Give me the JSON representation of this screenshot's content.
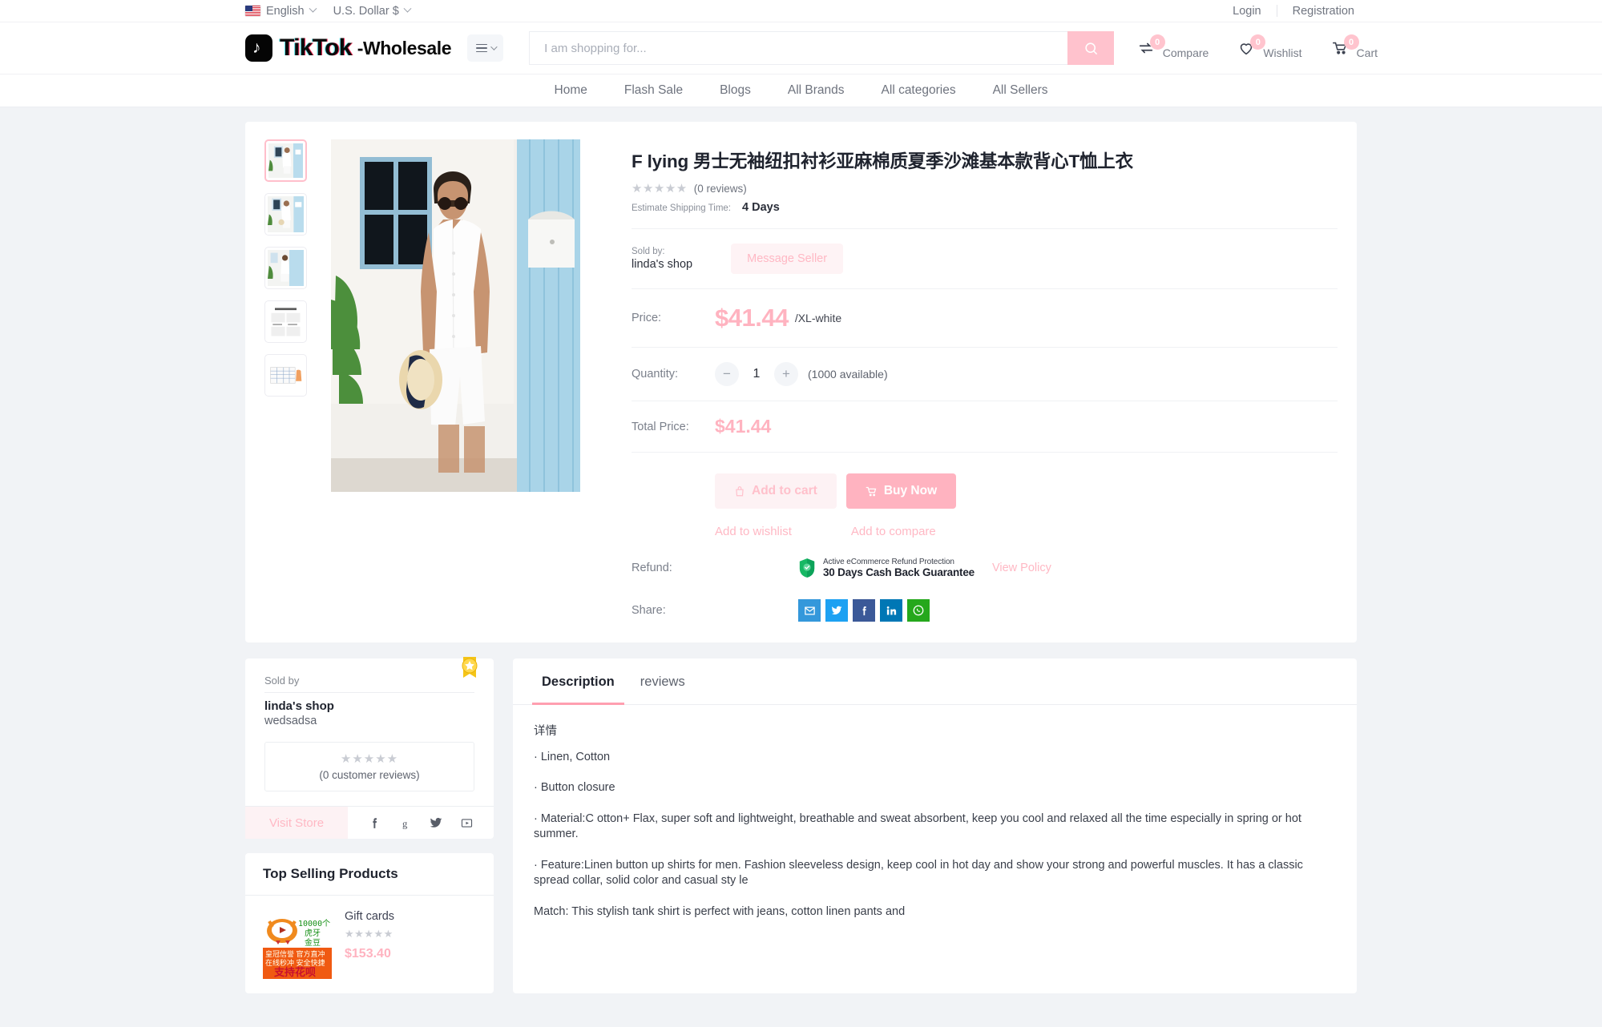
{
  "topbar": {
    "language": "English",
    "currency": "U.S. Dollar $",
    "login": "Login",
    "registration": "Registration"
  },
  "header": {
    "logo_text": "TikTok",
    "logo_suffix": "-Wholesale",
    "search_placeholder": "I am shopping for...",
    "icons": [
      {
        "name": "compare",
        "label": "Compare",
        "count": "0"
      },
      {
        "name": "wishlist",
        "label": "Wishlist",
        "count": "0"
      },
      {
        "name": "cart",
        "label": "Cart",
        "count": "0"
      }
    ]
  },
  "nav": {
    "items": [
      "Home",
      "Flash Sale",
      "Blogs",
      "All Brands",
      "All categories",
      "All Sellers"
    ]
  },
  "product": {
    "title": "F lying 男士无袖纽扣衬衫亚麻棉质夏季沙滩基本款背心T恤上衣",
    "stars": "★★★★★",
    "reviews_text": "(0 reviews)",
    "shipping_label": "Estimate Shipping Time:",
    "shipping_value": "4 Days",
    "sold_by_label": "Sold by:",
    "seller_name": "linda's shop",
    "message_seller": "Message Seller",
    "price_label": "Price:",
    "price": "$41.44",
    "price_variant": "/XL-white",
    "quantity_label": "Quantity:",
    "quantity_value": "1",
    "quantity_available": "(1000 available)",
    "total_label": "Total Price:",
    "total_price": "$41.44",
    "add_to_cart": "Add to cart",
    "buy_now": "Buy Now",
    "add_to_wishlist": "Add to wishlist",
    "add_to_compare": "Add to compare",
    "refund_label": "Refund:",
    "refund_top": "Active eCommerce Refund Protection",
    "refund_main": "30 Days Cash Back Guarantee",
    "view_policy": "View Policy",
    "share_label": "Share:",
    "share_buttons": [
      "email",
      "twitter",
      "facebook",
      "linkedin",
      "whatsapp"
    ]
  },
  "seller_card": {
    "sold_by": "Sold by",
    "shop_name": "linda's shop",
    "shop_desc": "wedsadsa",
    "stars": "★★★★★",
    "reviews": "(0 customer reviews)",
    "visit_store": "Visit Store",
    "socials": [
      "facebook",
      "google",
      "twitter",
      "youtube"
    ]
  },
  "top_selling": {
    "heading": "Top Selling Products",
    "items": [
      {
        "name": "Gift cards",
        "stars": "★★★★★",
        "price": "$153.40"
      }
    ]
  },
  "tabs": [
    {
      "label": "Description",
      "active": true
    },
    {
      "label": "reviews",
      "active": false
    }
  ],
  "description": {
    "heading": "详情",
    "lines": [
      "· Linen, Cotton",
      "· Button closure",
      "· Material:C otton+ Flax, super soft and lightweight, breathable and sweat absorbent, keep you cool and relaxed all the time especially in spring or hot summer.",
      "·  Feature:Linen button up shirts for men. Fashion sleeveless design, keep cool in hot day and show your strong and powerful muscles. It has a classic spread collar, solid color and casual sty le",
      "Match: This stylish tank shirt is perfect with jeans, cotton linen pants and"
    ]
  },
  "colors": {
    "accent_pink": "#ffb3c0",
    "soft_pink": "#fdf2f4",
    "badge_pink": "#ffc4ce"
  }
}
